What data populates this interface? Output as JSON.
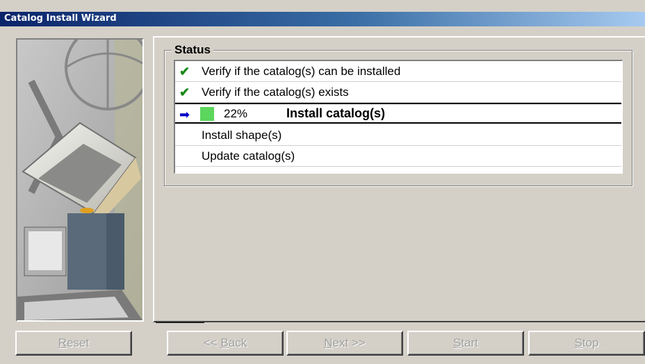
{
  "window": {
    "title": "Catalog Install Wizard"
  },
  "status": {
    "legend": "Status",
    "items": [
      {
        "state": "done",
        "icon": "checkmark-icon",
        "label": "Verify if the catalog(s) can be installed"
      },
      {
        "state": "done",
        "icon": "checkmark-icon",
        "label": "Verify if the catalog(s) exists"
      },
      {
        "state": "in-progress",
        "icon": "arrow-right-icon",
        "progress_text": "22%",
        "progress": 0.22,
        "label": "Install catalog(s)"
      },
      {
        "state": "pending",
        "label": "Install shape(s)"
      },
      {
        "state": "pending",
        "label": "Update catalog(s)"
      }
    ]
  },
  "buttons": {
    "reset": {
      "mnemonic": "R",
      "rest": "eset"
    },
    "back": {
      "prefix": "<< ",
      "mnemonic": "B",
      "rest": "ack"
    },
    "next": {
      "mnemonic": "N",
      "rest": "ext >>"
    },
    "start": {
      "mnemonic": "S",
      "rest": "tart"
    },
    "stop": {
      "mnemonic": "S",
      "rest": "top"
    }
  },
  "colors": {
    "titlebar_start": "#0a246a",
    "titlebar_end": "#a6caf0",
    "check": "#1a8a1a",
    "arrow": "#0000c8",
    "progress": "#5cd65c",
    "disabled_text": "#a0a0a0"
  }
}
